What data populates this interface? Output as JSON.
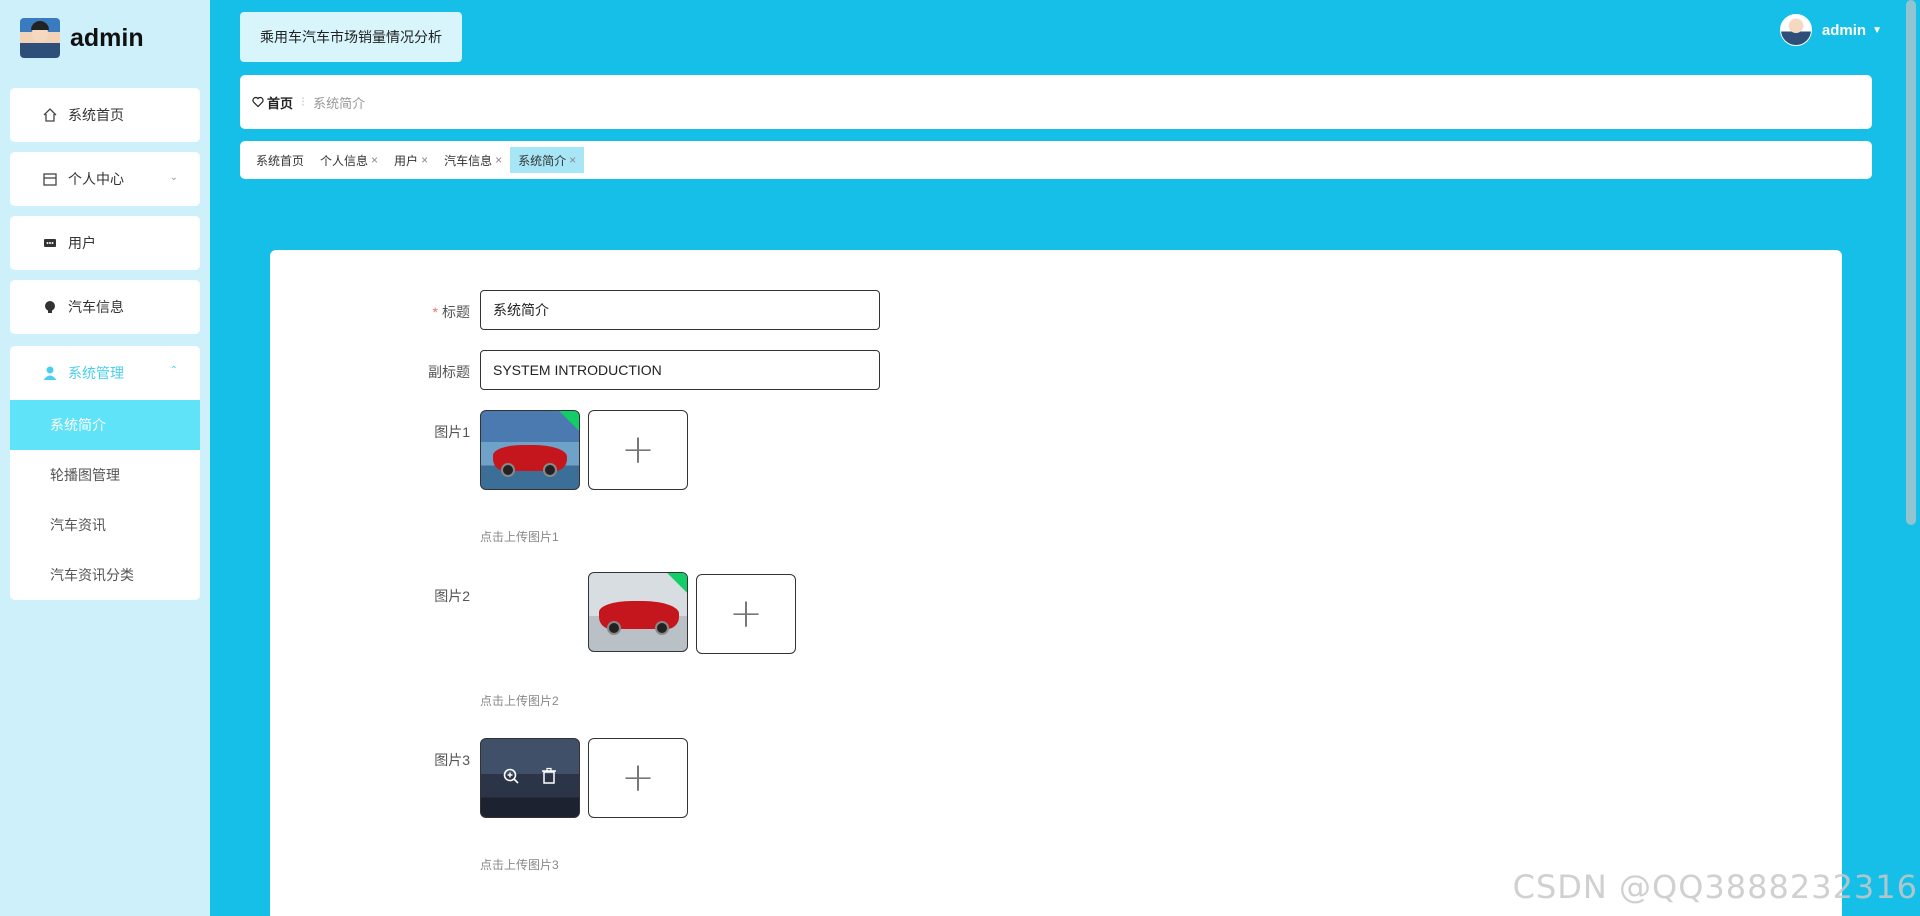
{
  "brand": {
    "name": "admin"
  },
  "header": {
    "system_title": "乘用车汽车市场销量情况分析",
    "username": "admin"
  },
  "sidebar": {
    "items": [
      {
        "label": "系统首页",
        "icon": "home-icon"
      },
      {
        "label": "个人中心",
        "icon": "calendar-icon"
      },
      {
        "label": "用户",
        "icon": "chat-icon"
      },
      {
        "label": "汽车信息",
        "icon": "bulb-icon"
      }
    ],
    "group": {
      "label": "系统管理",
      "icon": "user-icon",
      "children": [
        {
          "label": "系统简介",
          "active": true
        },
        {
          "label": "轮播图管理"
        },
        {
          "label": "汽车资讯"
        },
        {
          "label": "汽车资讯分类"
        }
      ]
    }
  },
  "breadcrumb": {
    "home": "首页",
    "current": "系统简介"
  },
  "tags": [
    {
      "label": "系统首页"
    },
    {
      "label": "个人信息",
      "closable": true
    },
    {
      "label": "用户",
      "closable": true
    },
    {
      "label": "汽车信息",
      "closable": true
    },
    {
      "label": "系统简介",
      "closable": true,
      "active": true
    }
  ],
  "form": {
    "title_label": "标题",
    "title_value": "系统简介",
    "subtitle_label": "副标题",
    "subtitle_value": "SYSTEM INTRODUCTION",
    "pic1_label": "图片1",
    "pic1_hint": "点击上传图片1",
    "pic2_label": "图片2",
    "pic2_hint": "点击上传图片2",
    "pic3_label": "图片3",
    "pic3_hint": "点击上传图片3"
  },
  "watermark": "CSDN @QQ3888232316",
  "colors": {
    "accent": "#16bfe8",
    "sidebar_bg": "#cdf0fb",
    "active_item": "#5ee3f8",
    "required": "#f56c6c"
  }
}
